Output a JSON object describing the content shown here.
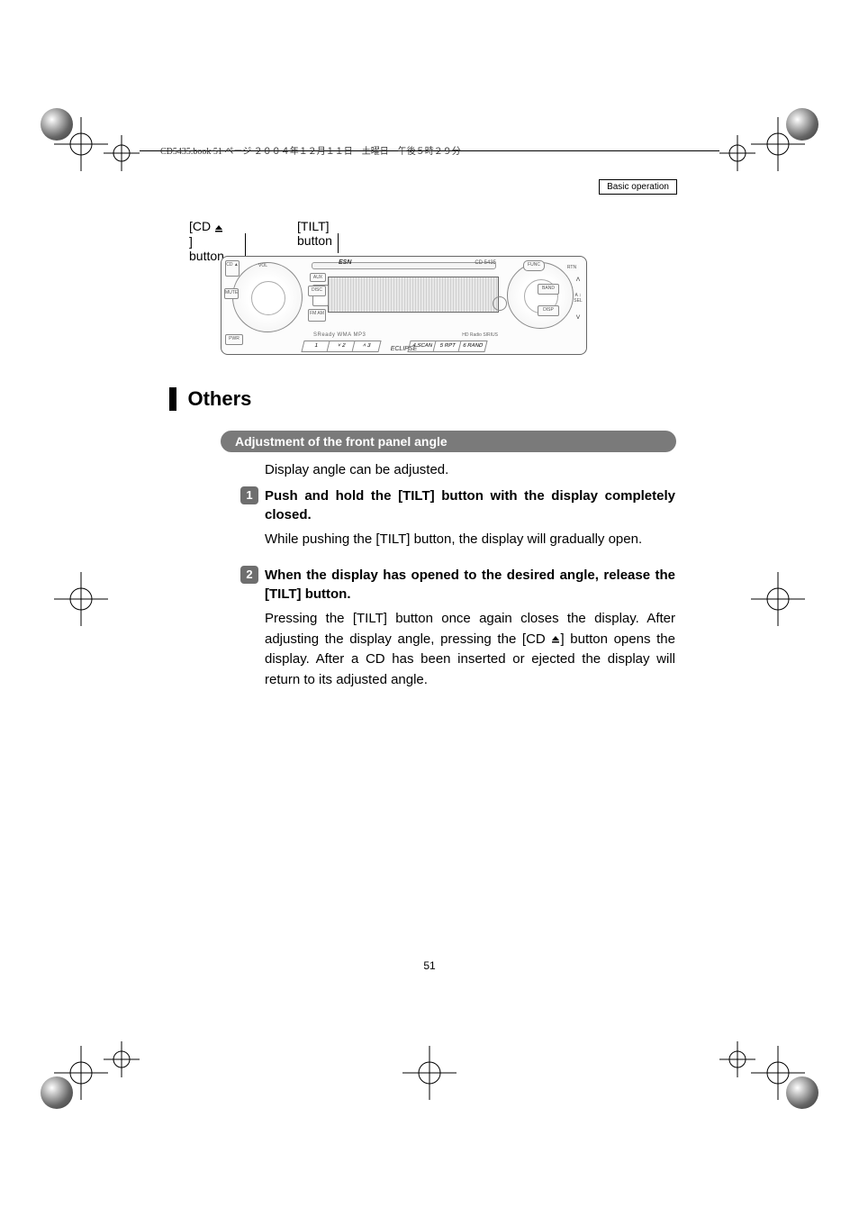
{
  "bookline": "CD5435.book  51 ページ  ２００４年１２月１１日　土曜日　午後５時２９分",
  "header_box": "Basic operation",
  "callout_cd": "[CD ",
  "callout_cd_suffix": "] button",
  "callout_tilt": "[TILT] button",
  "device": {
    "model": "CD 5435",
    "esn": "ESN",
    "cd": "CD ▲",
    "vol": "VOL",
    "mute": "MUTE",
    "aux": "AUX",
    "disc": "DISC",
    "fmam": "FM AM",
    "pwr": "PWR",
    "func": "FUNC",
    "rtn": "RTN",
    "band": "BAND",
    "disp": "DISP",
    "logos": "SReady WMA MP3",
    "logos2": "HD Radio  SIRIUS",
    "eclipse": "ECLIPSE",
    "p1": "1",
    "p2": "˅  2",
    "p3": "˄  3",
    "p4": "4 SCAN",
    "p5": "5 RPT",
    "p6": "6 RAND",
    "arr_up": "˄",
    "arr_dn": "˅",
    "arr_sel": "A ↕ SEL"
  },
  "section_title": "Others",
  "subhead": "Adjustment of the front panel angle",
  "intro": "Display angle can be adjusted.",
  "step1": {
    "num": "1",
    "head": "Push and hold the [TILT] button with the display completely closed.",
    "body": "While pushing the [TILT] button, the display will gradually open."
  },
  "step2": {
    "num": "2",
    "head": "When the display has opened to the desired angle, release the [TILT] button.",
    "body_a": "Pressing the [TILT] button once again closes the display. After adjusting the display angle, pressing the [CD ",
    "body_b": "] button opens the display. After a CD has been inserted or ejected the display will return to its adjusted angle."
  },
  "pagenum": "51"
}
